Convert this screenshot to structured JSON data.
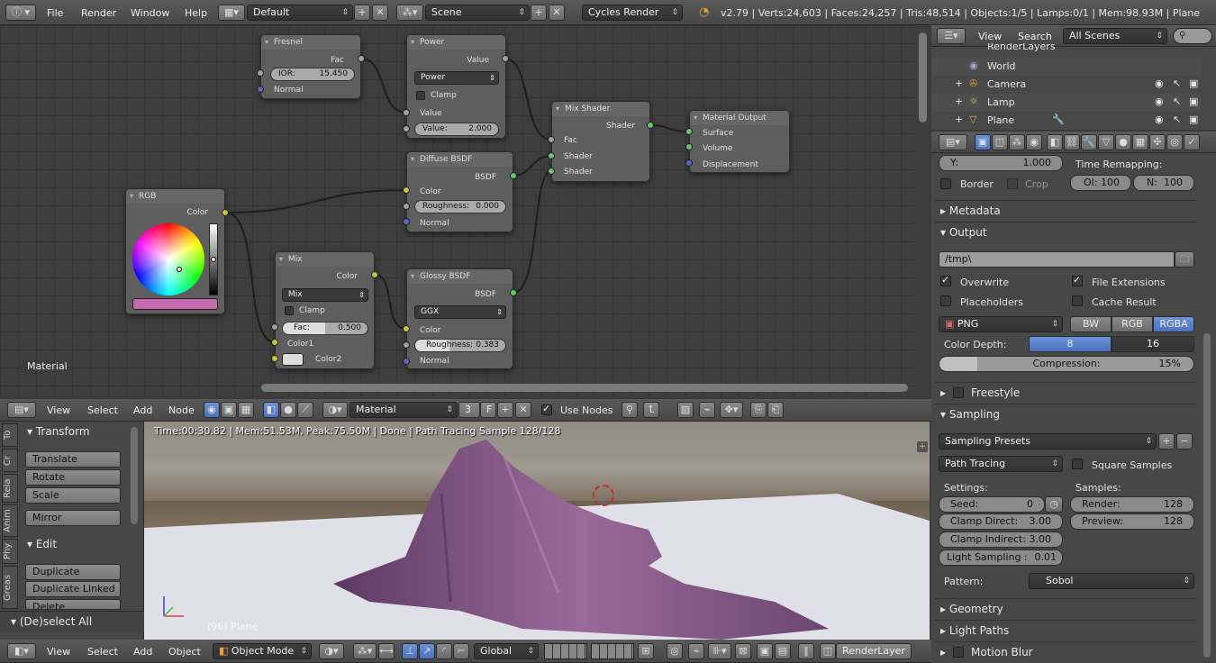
{
  "info_header": {
    "menus": [
      "File",
      "Render",
      "Window",
      "Help"
    ],
    "layout": "Default",
    "scene": "Scene",
    "engine": "Cycles Render",
    "stats": "v2.79 | Verts:24,603 | Faces:24,257 | Tris:48,514 | Objects:1/5 | Lamps:0/1 | Mem:98.93M | Plane"
  },
  "node_editor": {
    "label": "Material",
    "fresnel": {
      "title": "Fresnel",
      "out": "Fac",
      "ior_label": "IOR:",
      "ior": "15.450",
      "normal": "Normal"
    },
    "power": {
      "title": "Power",
      "out": "Value",
      "op": "Power",
      "clamp": "Clamp",
      "in": "Value",
      "val_label": "Value:",
      "val": "2.000"
    },
    "mixshader": {
      "title": "Mix Shader",
      "out": "Shader",
      "fac": "Fac",
      "s1": "Shader",
      "s2": "Shader"
    },
    "output": {
      "title": "Material Output",
      "surface": "Surface",
      "volume": "Volume",
      "displacement": "Displacement"
    },
    "diffuse": {
      "title": "Diffuse BSDF",
      "out": "BSDF",
      "color": "Color",
      "rough_label": "Roughness:",
      "rough": "0.000",
      "normal": "Normal"
    },
    "rgb": {
      "title": "RGB",
      "out": "Color",
      "swatch": "#c76bb0"
    },
    "mix": {
      "title": "Mix",
      "out": "Color",
      "op": "Mix",
      "clamp": "Clamp",
      "fac_label": "Fac:",
      "fac": "0.500",
      "fac_value": 0.5,
      "c1": "Color1",
      "c2": "Color2"
    },
    "glossy": {
      "title": "Glossy BSDF",
      "out": "BSDF",
      "dist": "GGX",
      "color": "Color",
      "rough_label": "Roughness:",
      "rough": "0.383",
      "rough_value": 0.383,
      "normal": "Normal"
    }
  },
  "node_header": {
    "menus": [
      "View",
      "Select",
      "Add",
      "Node"
    ],
    "material": "Material",
    "users": "3",
    "fake": "F",
    "use_nodes": "Use Nodes"
  },
  "tool_shelf": {
    "tabs": [
      "To",
      "Cr",
      "Rela",
      "Anim",
      "Phy",
      "Greas"
    ],
    "transform": "Transform",
    "transform_btns": [
      "Translate",
      "Rotate",
      "Scale"
    ],
    "mirror": "Mirror",
    "edit": "Edit",
    "edit_btns": [
      "Duplicate",
      "Duplicate Linked",
      "Delete"
    ],
    "deselect": "(De)select All"
  },
  "viewport": {
    "render_info": "Time:00:30.82 | Mem:51.53M, Peak:75.50M | Done | Path Tracing Sample 128/128",
    "object_label": "(96) Plane"
  },
  "view3d_header": {
    "menus": [
      "View",
      "Select",
      "Add",
      "Object"
    ],
    "mode": "Object Mode",
    "orientation": "Global",
    "render_layer": "RenderLayer"
  },
  "outliner": {
    "menus": [
      "View",
      "Search"
    ],
    "filter": "All Scenes",
    "items": [
      "RenderLayers",
      "World",
      "Camera",
      "Lamp",
      "Plane"
    ]
  },
  "properties": {
    "y_label": "Y:",
    "y_val": "1.000",
    "time_remap": "Time Remapping:",
    "border": "Border",
    "crop": "Crop",
    "old_label": "Ol:",
    "old": "100",
    "new_label": "N:",
    "new": "100",
    "metadata": "Metadata",
    "output": "Output",
    "path": "/tmp\\",
    "overwrite": "Overwrite",
    "file_ext": "File Extensions",
    "placeholders": "Placeholders",
    "cache": "Cache Result",
    "format": "PNG",
    "bw": "BW",
    "rgb": "RGB",
    "rgba": "RGBA",
    "depth_label": "Color Depth:",
    "depth8": "8",
    "depth16": "16",
    "comp_label": "Compression:",
    "comp": "15%",
    "comp_value": 0.15,
    "freestyle": "Freestyle",
    "sampling": "Sampling",
    "presets": "Sampling Presets",
    "integrator": "Path Tracing",
    "square": "Square Samples",
    "settings": "Settings:",
    "samples": "Samples:",
    "seed_label": "Seed:",
    "seed": "0",
    "clamp_d_label": "Clamp Direct:",
    "clamp_d": "3.00",
    "clamp_i_label": "Clamp Indirect:",
    "clamp_i": "3.00",
    "light_label": "Light Sampling :",
    "light": "0.01",
    "render_label": "Render:",
    "render": "128",
    "preview_label": "Preview:",
    "preview": "128",
    "pattern_label": "Pattern:",
    "pattern": "Sobol",
    "geometry": "Geometry",
    "light_paths": "Light Paths",
    "motion_blur": "Motion Blur"
  },
  "colors": {
    "accent": "#5a86d4",
    "socket_yellow": "#c7c729",
    "socket_green": "#63c763",
    "socket_blue": "#6363c7",
    "cloth": "#8a5a86"
  }
}
